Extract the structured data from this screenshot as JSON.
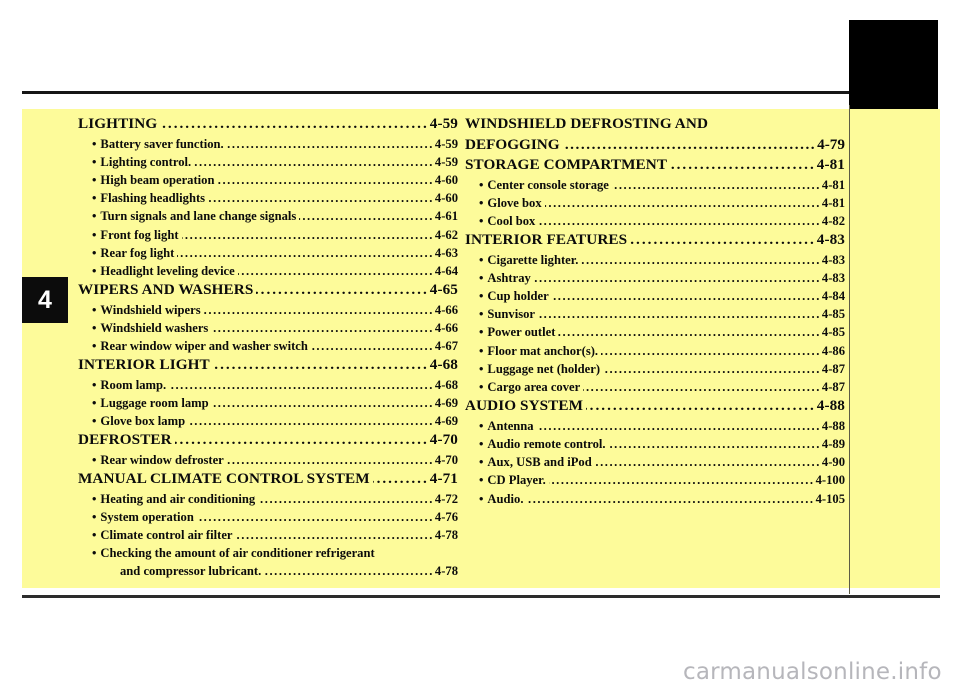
{
  "page": {
    "chapter_number": "4",
    "background_color": "#ffffff",
    "panel_color": "#fdfb9a",
    "tab_color": "#000000",
    "text_color": "#0b0b0b"
  },
  "watermark": {
    "text": "carmanualsonline.info",
    "color": "#b6b6bb"
  },
  "toc": {
    "left_column": [
      {
        "level": "major",
        "title": "LIGHTING",
        "leader": true,
        "page": "4-59"
      },
      {
        "level": "sub",
        "title": "Battery saver function.",
        "leader": true,
        "page": "4-59"
      },
      {
        "level": "sub",
        "title": "Lighting control.",
        "leader": true,
        "page": "4-59"
      },
      {
        "level": "sub",
        "title": "High beam operation",
        "leader": true,
        "page": "4-60"
      },
      {
        "level": "sub",
        "title": "Flashing headlights",
        "leader": true,
        "page": "4-60"
      },
      {
        "level": "sub",
        "title": "Turn signals and lane change signals",
        "leader": true,
        "page": "4-61"
      },
      {
        "level": "sub",
        "title": "Front fog light",
        "leader": true,
        "page": "4-62"
      },
      {
        "level": "sub",
        "title": "Rear fog light",
        "leader": true,
        "page": "4-63"
      },
      {
        "level": "sub",
        "title": "Headlight leveling device",
        "leader": true,
        "page": "4-64"
      },
      {
        "level": "major",
        "title": "WIPERS AND WASHERS",
        "leader": true,
        "page": "4-65"
      },
      {
        "level": "sub",
        "title": "Windshield wipers",
        "leader": true,
        "page": "4-66"
      },
      {
        "level": "sub",
        "title": "Windshield washers",
        "leader": true,
        "page": "4-66"
      },
      {
        "level": "sub",
        "title": "Rear window wiper and washer switch",
        "leader": true,
        "page": "4-67"
      },
      {
        "level": "major",
        "title": "INTERIOR LIGHT",
        "leader": true,
        "page": "4-68"
      },
      {
        "level": "sub",
        "title": "Room lamp.",
        "leader": true,
        "page": "4-68"
      },
      {
        "level": "sub",
        "title": "Luggage room lamp",
        "leader": true,
        "page": "4-69"
      },
      {
        "level": "sub",
        "title": "Glove box lamp",
        "leader": true,
        "page": "4-69"
      },
      {
        "level": "major",
        "title": "DEFROSTER",
        "leader": true,
        "page": "4-70"
      },
      {
        "level": "sub",
        "title": "Rear window defroster",
        "leader": true,
        "page": "4-70"
      },
      {
        "level": "major",
        "title": "MANUAL CLIMATE CONTROL SYSTEM",
        "leader": true,
        "page": "4-71"
      },
      {
        "level": "sub",
        "title": "Heating and air conditioning",
        "leader": true,
        "page": "4-72"
      },
      {
        "level": "sub",
        "title": "System operation",
        "leader": true,
        "page": "4-76"
      },
      {
        "level": "sub",
        "title": "Climate control air filter",
        "leader": true,
        "page": "4-78"
      },
      {
        "level": "sub",
        "title": "Checking the amount of air conditioner refrigerant",
        "leader": false,
        "page": ""
      },
      {
        "level": "cont",
        "title": "and compressor lubricant.",
        "leader": true,
        "page": "4-78"
      }
    ],
    "right_column": [
      {
        "level": "major",
        "title": "WINDSHIELD DEFROSTING AND",
        "leader": false,
        "page": ""
      },
      {
        "level": "major-cont",
        "title": "DEFOGGING",
        "leader": true,
        "page": "4-79"
      },
      {
        "level": "major",
        "title": "STORAGE COMPARTMENT",
        "leader": true,
        "page": "4-81"
      },
      {
        "level": "sub",
        "title": "Center console storage",
        "leader": true,
        "page": "4-81"
      },
      {
        "level": "sub",
        "title": "Glove box",
        "leader": true,
        "page": "4-81"
      },
      {
        "level": "sub",
        "title": "Cool box",
        "leader": true,
        "page": "4-82"
      },
      {
        "level": "major",
        "title": "INTERIOR FEATURES",
        "leader": true,
        "page": "4-83"
      },
      {
        "level": "sub",
        "title": "Cigarette lighter.",
        "leader": true,
        "page": "4-83"
      },
      {
        "level": "sub",
        "title": "Ashtray",
        "leader": true,
        "page": "4-83"
      },
      {
        "level": "sub",
        "title": "Cup holder",
        "leader": true,
        "page": "4-84"
      },
      {
        "level": "sub",
        "title": "Sunvisor",
        "leader": true,
        "page": "4-85"
      },
      {
        "level": "sub",
        "title": "Power outlet",
        "leader": true,
        "page": "4-85"
      },
      {
        "level": "sub",
        "title": "Floor mat anchor(s).",
        "leader": true,
        "page": "4-86"
      },
      {
        "level": "sub",
        "title": "Luggage net (holder)",
        "leader": true,
        "page": "4-87"
      },
      {
        "level": "sub",
        "title": "Cargo area cover",
        "leader": true,
        "page": "4-87"
      },
      {
        "level": "major",
        "title": "AUDIO SYSTEM",
        "leader": true,
        "page": "4-88"
      },
      {
        "level": "sub",
        "title": "Antenna",
        "leader": true,
        "page": "4-88"
      },
      {
        "level": "sub",
        "title": "Audio remote control.",
        "leader": true,
        "page": "4-89"
      },
      {
        "level": "sub",
        "title": "Aux, USB and iPod",
        "leader": true,
        "page": "4-90"
      },
      {
        "level": "sub",
        "title": "CD Player.",
        "leader": true,
        "page": "4-100"
      },
      {
        "level": "sub",
        "title": "Audio.",
        "leader": true,
        "page": "4-105"
      }
    ]
  }
}
